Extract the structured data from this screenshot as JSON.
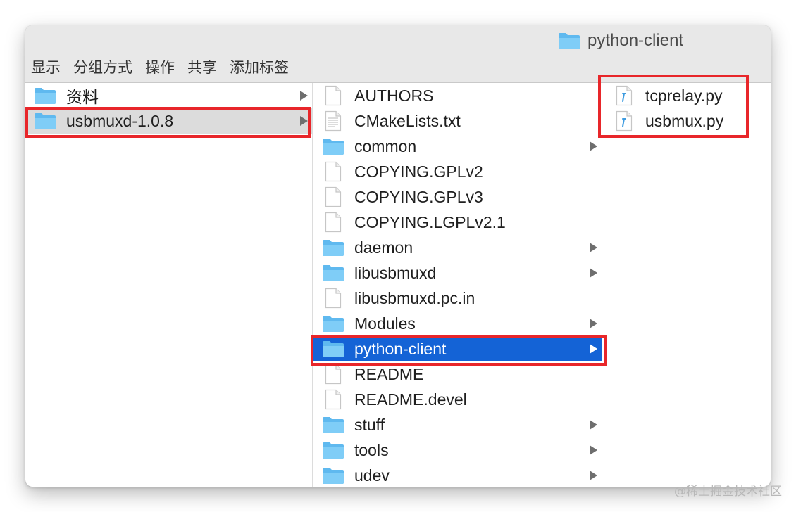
{
  "window": {
    "title": "python-client"
  },
  "toolbar": {
    "items": [
      "显示",
      "分组方式",
      "操作",
      "共享",
      "添加标签"
    ]
  },
  "column1": {
    "items": [
      {
        "label": "资料",
        "type": "folder"
      },
      {
        "label": "usbmuxd-1.0.8",
        "type": "folder",
        "selected": true
      }
    ]
  },
  "column2": {
    "items": [
      {
        "label": "AUTHORS",
        "type": "file"
      },
      {
        "label": "CMakeLists.txt",
        "type": "text-file"
      },
      {
        "label": "common",
        "type": "folder"
      },
      {
        "label": "COPYING.GPLv2",
        "type": "file"
      },
      {
        "label": "COPYING.GPLv3",
        "type": "file"
      },
      {
        "label": "COPYING.LGPLv2.1",
        "type": "file"
      },
      {
        "label": "daemon",
        "type": "folder"
      },
      {
        "label": "libusbmuxd",
        "type": "folder"
      },
      {
        "label": "libusbmuxd.pc.in",
        "type": "file"
      },
      {
        "label": "Modules",
        "type": "folder"
      },
      {
        "label": "python-client",
        "type": "folder",
        "selected": true
      },
      {
        "label": "README",
        "type": "file"
      },
      {
        "label": "README.devel",
        "type": "file"
      },
      {
        "label": "stuff",
        "type": "folder"
      },
      {
        "label": "tools",
        "type": "folder"
      },
      {
        "label": "udev",
        "type": "folder"
      }
    ]
  },
  "column3": {
    "items": [
      {
        "label": "tcprelay.py",
        "type": "python-file"
      },
      {
        "label": "usbmux.py",
        "type": "python-file"
      }
    ]
  },
  "colors": {
    "selection_blue": "#1463d6",
    "selection_gray": "#dcdcdc",
    "highlight_red": "#e8262a",
    "folder_blue": "#6cc4f5"
  },
  "watermark": "@稀土掘金技术社区"
}
